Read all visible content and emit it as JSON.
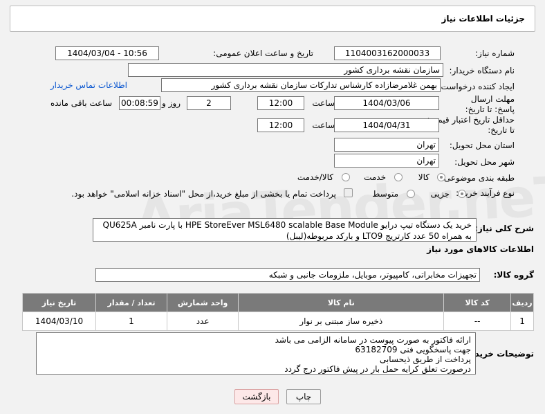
{
  "header": {
    "title": "جزئیات اطلاعات نیاز"
  },
  "fields": {
    "need_number_label": "شماره نیاز:",
    "need_number": "1104003162000033",
    "announce_label": "تاریخ و ساعت اعلان عمومی:",
    "announce_value": "1404/03/04 - 10:56",
    "buyer_org_label": "نام دستگاه خریدار:",
    "buyer_org": "سازمان نقشه برداری کشور",
    "creator_label": "ایجاد کننده درخواست:",
    "creator": "بهمن غلامرضازاده کارشناس تدارکات  سازمان نقشه برداری کشور",
    "contact_link": "اطلاعات تماس خریدار",
    "deadline_label": "مهلت ارسال پاسخ: تا تاریخ:",
    "deadline_date": "1404/03/06",
    "time_label": "ساعت",
    "deadline_time": "12:00",
    "days_value": "2",
    "days_label": "روز و",
    "remaining_value": "00:08:59",
    "remaining_label": "ساعت باقی مانده",
    "validity_label": "حداقل تاریخ اعتبار قیمت: تا تاریخ:",
    "validity_date": "1404/04/31",
    "validity_time": "12:00",
    "province_label": "استان محل تحویل:",
    "province": "تهران",
    "city_label": "شهر محل تحویل:",
    "city": "تهران",
    "category_label": "طبقه بندی موضوعی:",
    "category_options": [
      "کالا",
      "خدمت",
      "کالا/خدمت"
    ],
    "process_label": "نوع فرآیند خرید :",
    "process_options": [
      "جزیی",
      "متوسط"
    ],
    "payment_note": "پرداخت تمام یا بخشی از مبلغ خرید،از محل \"اسناد خزانه اسلامی\" خواهد بود."
  },
  "description": {
    "label": "شرح کلی نیاز:",
    "line1": "خرید یک دستگاه تیپ درایو HPE StoreEver MSL6480 scalable Base Module با پارت نامبر QU625A",
    "line2": "به همراه 50 عدد کارتریج LTO9 و بارکد مربوطه(لیبل)"
  },
  "goods_section": {
    "title": "اطلاعات کالاهای مورد نیاز",
    "group_label": "گروه کالا:",
    "group_value": "تجهیزات مخابراتی، کامپیوتر، موبایل، ملزومات جانبی و شبکه"
  },
  "table": {
    "headers": [
      "ردیف",
      "کد کالا",
      "نام کالا",
      "واحد شمارش",
      "تعداد / مقدار",
      "تاریخ نیاز"
    ],
    "rows": [
      [
        "1",
        "--",
        "ذخیره ساز مبتنی بر نوار",
        "عدد",
        "1",
        "1404/03/10"
      ]
    ]
  },
  "buyer_notes": {
    "label": "توضیحات خریدار:",
    "lines": [
      "ارائه فاکتور به صورت پیوست در سامانه  الزامی می باشد",
      "جهت پاسخگویی فنی 63182709",
      "پرداخت از طریق ذیحسابی",
      "درصورت تعلق کرایه حمل بار در پیش فاکتور درج گردد"
    ]
  },
  "buttons": {
    "print": "چاپ",
    "back": "بازگشت"
  },
  "watermark": "AriaTender.neT"
}
